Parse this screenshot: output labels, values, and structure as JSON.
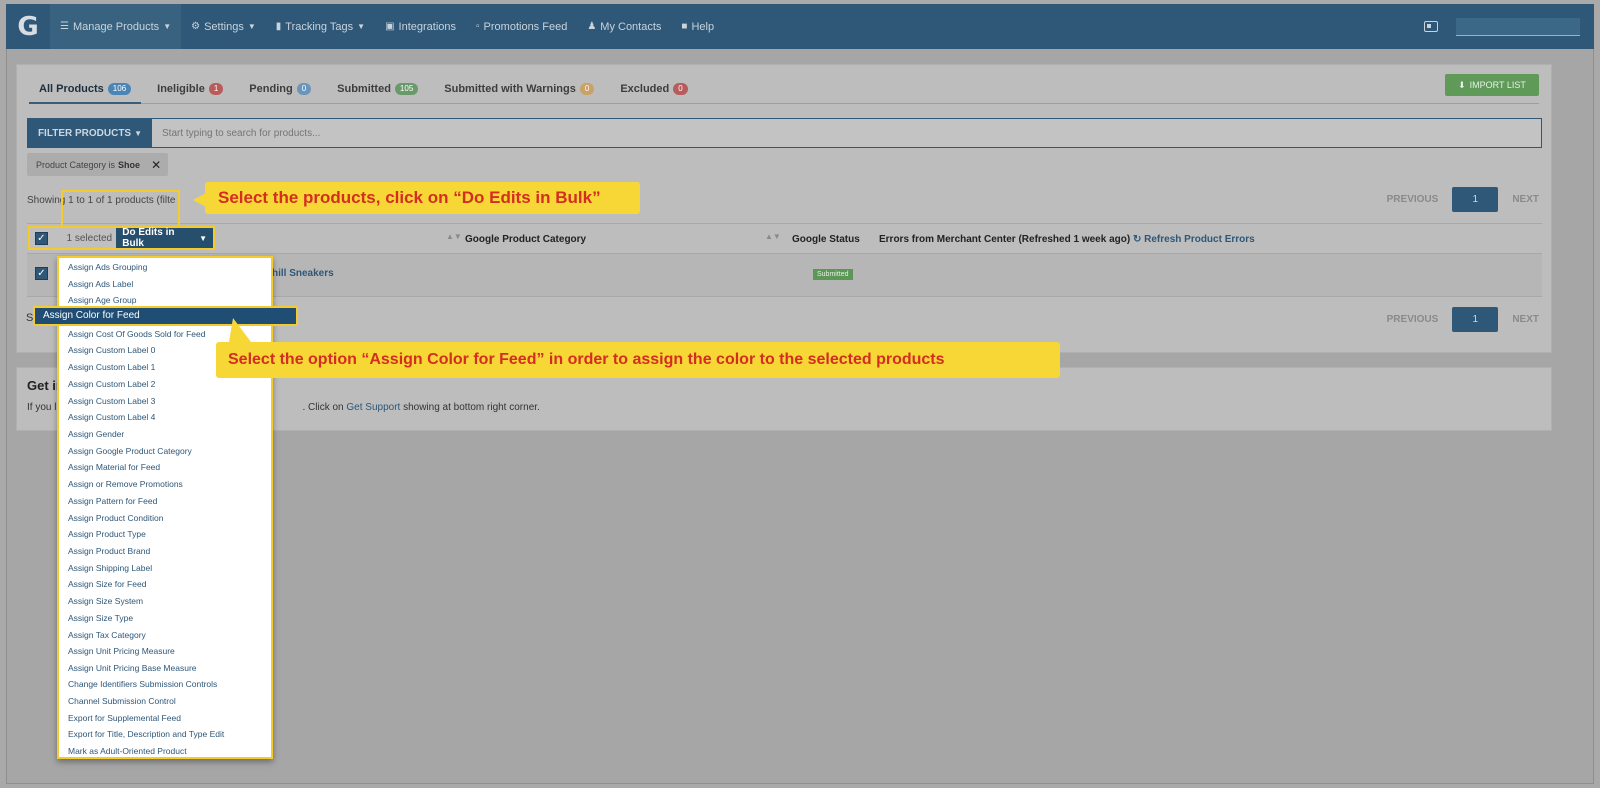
{
  "nav": {
    "logo": "G",
    "items": [
      {
        "label": "Manage Products",
        "icon": "list-icon",
        "caret": true
      },
      {
        "label": "Settings",
        "icon": "gear-icon",
        "caret": true
      },
      {
        "label": "Tracking Tags",
        "icon": "bar-chart-icon",
        "caret": true
      },
      {
        "label": "Integrations",
        "icon": "briefcase-icon",
        "caret": false
      },
      {
        "label": "Promotions Feed",
        "icon": "clipboard-icon",
        "caret": false
      },
      {
        "label": "My Contacts",
        "icon": "users-icon",
        "caret": false
      },
      {
        "label": "Help",
        "icon": "help-icon",
        "caret": false
      }
    ]
  },
  "tabs": [
    {
      "label": "All Products",
      "count": "106"
    },
    {
      "label": "Ineligible",
      "count": "1"
    },
    {
      "label": "Pending",
      "count": "0"
    },
    {
      "label": "Submitted",
      "count": "105"
    },
    {
      "label": "Submitted with Warnings",
      "count": "0"
    },
    {
      "label": "Excluded",
      "count": "0"
    }
  ],
  "import_label": "IMPORT LIST",
  "filter": {
    "button": "FILTER PRODUCTS",
    "placeholder": "Start typing to search for products..."
  },
  "chip": {
    "prefix": "Product Category is",
    "value": "Shoe",
    "close": "✕"
  },
  "showing": "Showing 1 to 1 of 1 products (filte",
  "showing_tail": "ed)",
  "pager": {
    "previous": "PREVIOUS",
    "page": "1",
    "next": "NEXT"
  },
  "table": {
    "headers": {
      "category": "Google Product Category",
      "status": "Google Status",
      "errors": "Errors from Merchant Center (Refreshed 1 week ago)",
      "refresh": "Refresh Product Errors"
    },
    "row": {
      "product": "hill Sneakers",
      "status": "Submitted"
    }
  },
  "selection": {
    "count": "1 selected",
    "bulk_button": "Do Edits in Bulk"
  },
  "dropdown": [
    "Assign Ads Grouping",
    "Assign Ads Label",
    "Assign Age Group",
    "Assign Color for Feed",
    "Assign Cost Of Goods Sold for Feed",
    "Assign Custom Label 0",
    "Assign Custom Label 1",
    "Assign Custom Label 2",
    "Assign Custom Label 3",
    "Assign Custom Label 4",
    "Assign Gender",
    "Assign Google Product Category",
    "Assign Material for Feed",
    "Assign or Remove Promotions",
    "Assign Pattern for Feed",
    "Assign Product Condition",
    "Assign Product Type",
    "Assign Product Brand",
    "Assign Shipping Label",
    "Assign Size for Feed",
    "Assign Size System",
    "Assign Size Type",
    "Assign Tax Category",
    "Assign Unit Pricing Measure",
    "Assign Unit Pricing Base Measure",
    "Change Identifiers Submission Controls",
    "Channel Submission Control",
    "Export for Supplemental Feed",
    "Export for Title, Description and Type Edit",
    "Mark as Adult-Oriented Product"
  ],
  "get_info": {
    "title": "Get in",
    "text_start": "If you l",
    "text_mid": ". Click on ",
    "link": "Get Support",
    "text_end": " showing at bottom right corner."
  },
  "panel_s": "S",
  "callouts": {
    "first": "Select the products, click on “Do Edits in Bulk”",
    "second": "Select the option “Assign Color for Feed” in order to assign the color to the selected products"
  }
}
